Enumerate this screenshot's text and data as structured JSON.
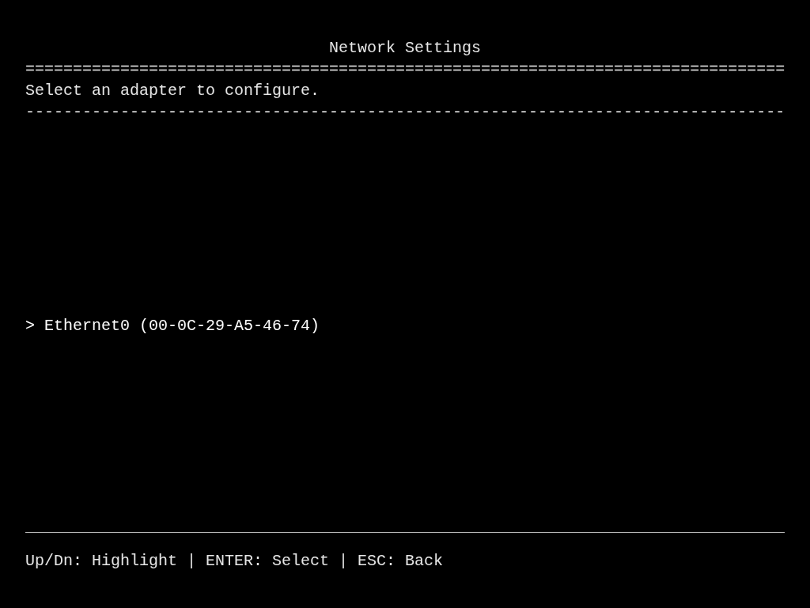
{
  "title": "Network Settings",
  "double_rule": "================================================================================",
  "prompt": "Select an adapter to configure.",
  "single_rule": "--------------------------------------------------------------------------------",
  "cursor": ">",
  "adapters": [
    {
      "label": "Ethernet0 (00-0C-29-A5-46-74)",
      "selected": true
    }
  ],
  "footer": "Up/Dn: Highlight | ENTER: Select | ESC: Back"
}
